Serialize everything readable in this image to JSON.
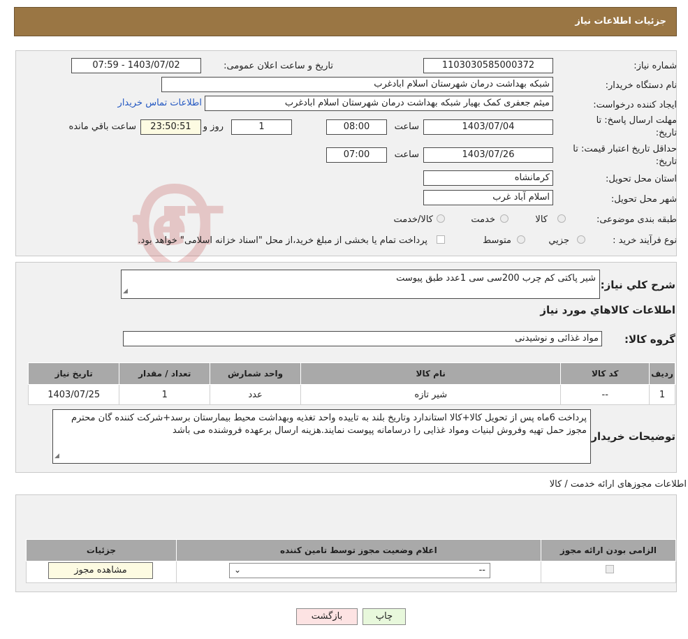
{
  "header": {
    "title": "جزئیات اطلاعات نیاز"
  },
  "watermark": {
    "text": "AriaTender.neT"
  },
  "fields": {
    "need_number_label": "شماره نیاز:",
    "need_number": "1103030585000372",
    "announce_label": "تاریخ و ساعت اعلان عمومی:",
    "announce_value": "1403/07/02 - 07:59",
    "buyer_org_label": "نام دستگاه خریدار:",
    "buyer_org": "شبکه بهداشت درمان شهرستان اسلام ابادغرب",
    "creator_label": "ایجاد کننده درخواست:",
    "creator": "میثم جعفری کمک بهیار شبکه بهداشت درمان شهرستان اسلام ابادغرب",
    "contact_link": "اطلاعات تماس خریدار",
    "deadline_label_1": "مهلت ارسال پاسخ: تا",
    "deadline_label_2": "تاریخ:",
    "deadline_date": "1403/07/04",
    "time_label": "ساعت",
    "deadline_time": "08:00",
    "days_value": "1",
    "days_label": "روز و",
    "remaining_time": "23:50:51",
    "remaining_label": "ساعت باقي مانده",
    "validity_label_1": "حداقل تاریخ اعتبار قیمت: تا",
    "validity_label_2": "تاریخ:",
    "validity_date": "1403/07/26",
    "validity_time": "07:00",
    "province_label": "استان محل تحویل:",
    "province": "کرمانشاه",
    "city_label": "شهر محل تحویل:",
    "city": "اسلام آباد غرب",
    "category_label": "طبقه بندی موضوعی:",
    "cat_goods": "کالا",
    "cat_service": "خدمت",
    "cat_goods_service": "کالا/خدمت",
    "process_label": "نوع فرآیند خرید :",
    "proc_partial": "جزیي",
    "proc_medium": "متوسط",
    "payment_note": "پرداخت تمام یا بخشی از مبلغ خرید،از محل \"اسناد خزانه اسلامی\" خواهد بود."
  },
  "summary": {
    "label": "شرح کلي نياز:",
    "text": "شیر پاکتی کم چرب 200سی سی 1عدد طبق پیوست",
    "goods_info_title": "اطلاعات کالاهاي مورد نياز",
    "group_label": "گروه کالا:",
    "group_value": "مواد غذائی و نوشیدنی"
  },
  "goods_table": {
    "headers": [
      "رديف",
      "کد کالا",
      "نام کالا",
      "واحد شمارش",
      "تعداد / مقدار",
      "تاریخ نیاز"
    ],
    "rows": [
      [
        "1",
        "--",
        "شیر تازه",
        "عدد",
        "1",
        "1403/07/25"
      ]
    ]
  },
  "buyer_notes": {
    "label": "توضيحات خريدار:",
    "text": "پرداخت 6ماه پس از تحویل کالا+کالا استاندارد وتاریخ بلند به تاییده واحد تغذیه وبهداشت محیط بیمارستان برسد+شرکت کننده گان محترم مجوز حمل تهیه وفروش لبنیات ومواد غذایی  را درسامانه پیوست نمایند.هزینه ارسال برعهده فروشنده می باشد"
  },
  "licenses": {
    "title": "اطلاعات مجوزهای ارائه خدمت / کالا",
    "headers": [
      "الزامی بودن ارائه مجوز",
      "اعلام وضعیت مجوز توسط تامین کننده",
      "جزئیات"
    ],
    "select_value": "--",
    "view_button": "مشاهده مجوز"
  },
  "footer": {
    "print_button": "چاپ",
    "back_button": "بازگشت"
  },
  "colors": {
    "header_bg": "#9a7644",
    "panel_bg": "#f1f1f1",
    "table_header_bg": "#a9a9a9",
    "link": "#2458c2",
    "print_btn": "#e8f8dc",
    "back_btn": "#fde3e3"
  }
}
